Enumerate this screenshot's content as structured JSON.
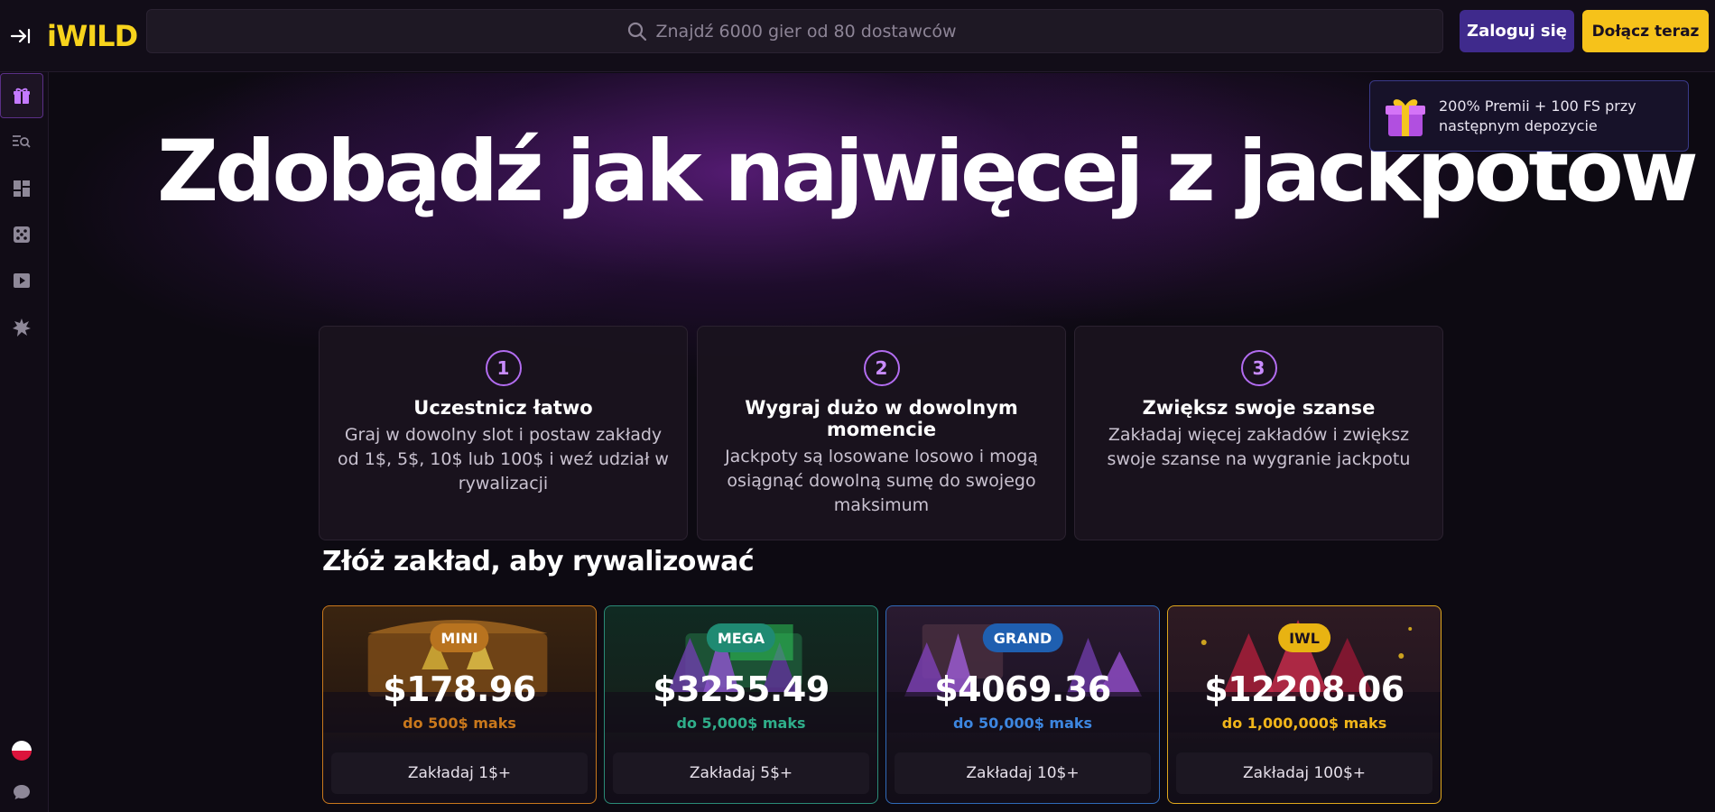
{
  "header": {
    "logo": "iWILD",
    "search_placeholder": "Znajdź 6000 gier od 80 dostawców",
    "login_label": "Zaloguj się",
    "join_label": "Dołącz teraz"
  },
  "sidebar": {
    "items": [
      {
        "icon": "gift-icon",
        "active": true
      },
      {
        "icon": "search-list-icon",
        "active": false
      },
      {
        "icon": "dashboard-icon",
        "active": false
      },
      {
        "icon": "dice-icon",
        "active": false
      },
      {
        "icon": "play-icon",
        "active": false
      },
      {
        "icon": "burst-icon",
        "active": false
      }
    ],
    "bottom": [
      {
        "icon": "poland-flag-icon"
      },
      {
        "icon": "chat-icon"
      }
    ]
  },
  "promo": {
    "text": "200% Premii + 100 FS przy następnym depozycie",
    "icon": "gift-box-icon"
  },
  "hero": {
    "title": "Zdobądź jak najwięcej z jackpotów"
  },
  "steps": [
    {
      "number": "1",
      "title": "Uczestnicz łatwo",
      "desc": "Graj w dowolny slot i postaw zakłady od 1$, 5$, 10$ lub 100$ i weź udział w rywalizacji"
    },
    {
      "number": "2",
      "title": "Wygraj dużo w dowolnym momencie",
      "desc": "Jackpoty są losowane losowo i mogą osiągnąć dowolną sumę do swojego maksimum"
    },
    {
      "number": "3",
      "title": "Zwiększ swoje szanse",
      "desc": "Zakładaj więcej zakładów i zwiększ swoje szanse na wygranie jackpotu"
    }
  ],
  "section": {
    "title": "Złóż zakład, aby rywalizować"
  },
  "jackpots": [
    {
      "tier": "MINI",
      "amount": "$178.96",
      "max": "do 500$ maks",
      "button": "Zakładaj 1$+",
      "color": "#c9781c",
      "badge_color": "#b8731f",
      "border": "#c9781c"
    },
    {
      "tier": "MEGA",
      "amount": "$3255.49",
      "max": "do 5,000$ maks",
      "button": "Zakładaj 5$+",
      "color": "#2fae8a",
      "badge_color": "#1f8a72",
      "border": "#2a8a76"
    },
    {
      "tier": "GRAND",
      "amount": "$4069.36",
      "max": "do 50,000$ maks",
      "button": "Zakładaj 10$+",
      "color": "#3d86e0",
      "badge_color": "#1f5fb0",
      "border": "#2f6ab8"
    },
    {
      "tier": "IWL",
      "amount": "$12208.06",
      "max": "do 1,000,000$ maks",
      "button": "Zakładaj 100$+",
      "color": "#f0b51a",
      "badge_color": "#e8b312",
      "border": "#e0a81c"
    }
  ]
}
